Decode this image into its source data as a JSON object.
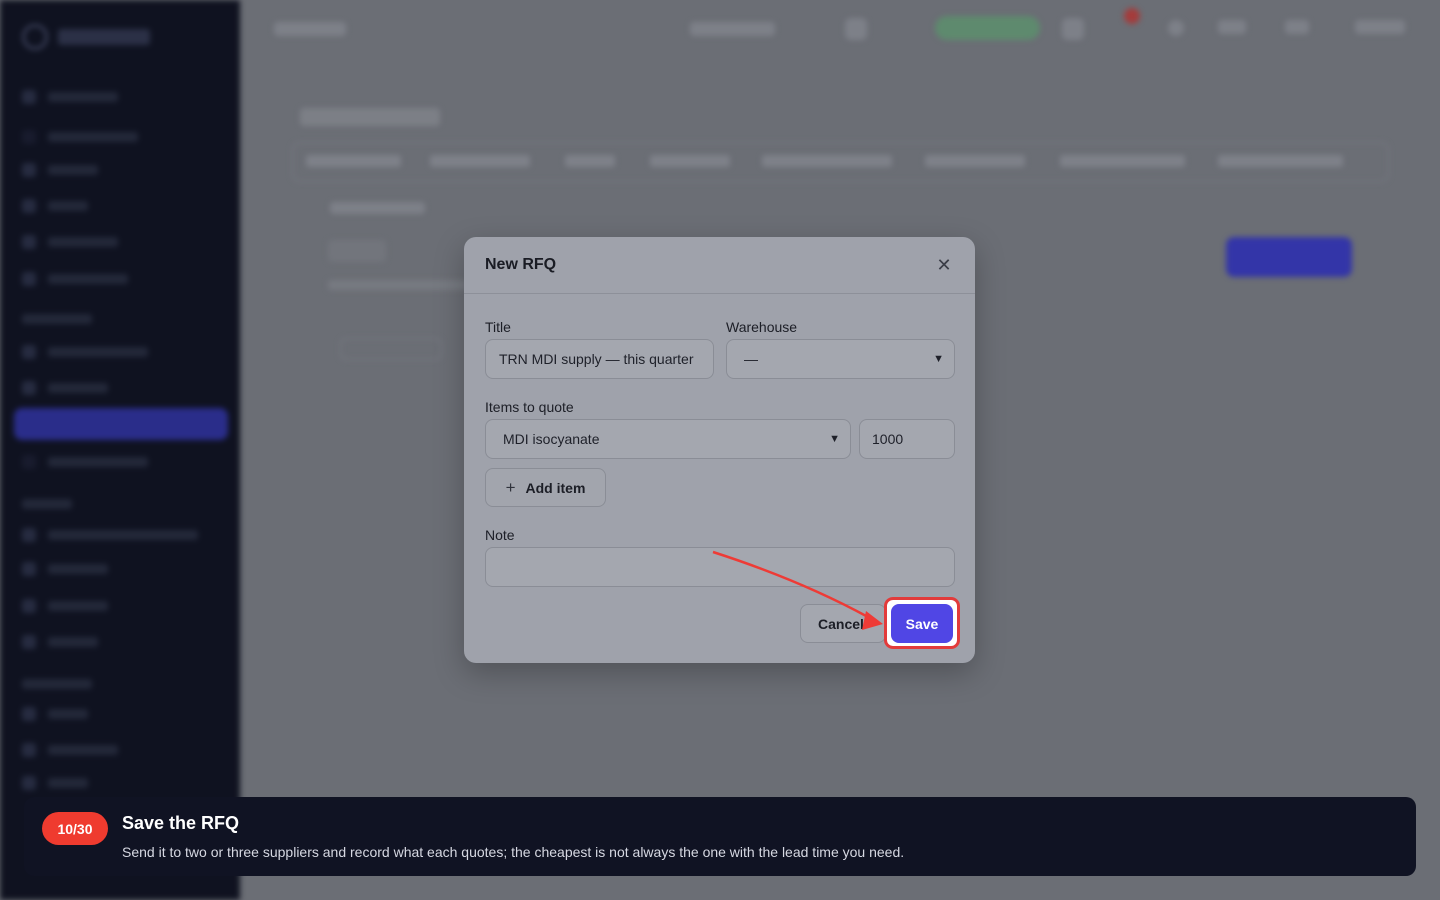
{
  "modal": {
    "title": "New RFQ",
    "close_icon": "close-icon",
    "title_label": "Title",
    "title_value": "TRN MDI supply — this quarter",
    "warehouse_label": "Warehouse",
    "warehouse_value": "—",
    "items_label": "Items to quote",
    "item_product": "MDI isocyanate",
    "item_quantity": "1000",
    "add_item_label": "Add item",
    "note_label": "Note",
    "note_value": "",
    "cancel_label": "Cancel",
    "save_label": "Save"
  },
  "tour": {
    "step": "10/30",
    "title": "Save the RFQ",
    "description": "Send it to two or three suppliers and record what each quotes; the cheapest is not always the one with the lead time you need."
  },
  "colors": {
    "accent": "#5046e5",
    "highlight": "#e23b3b",
    "badge": "#ef3b2f",
    "banner": "#101323"
  }
}
